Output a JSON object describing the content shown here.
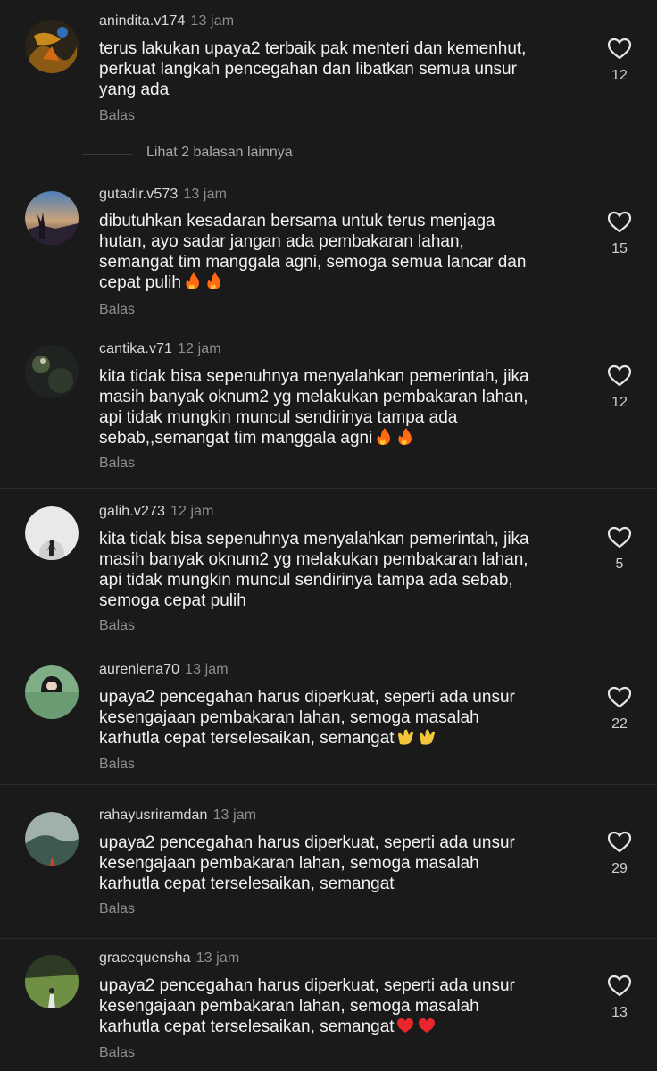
{
  "comments": [
    {
      "username": "anindita.v174",
      "time": "13 jam",
      "text": "terus lakukan upaya2 terbaik pak menteri dan kemenhut,\nperkuat langkah pencegahan dan libatkan semua unsur\nyang ada",
      "reply": "Balas",
      "likes": "12"
    },
    {
      "username": "gutadir.v573",
      "time": "13 jam",
      "text": "dibutuhkan kesadaran bersama untuk terus menjaga\nhutan, ayo sadar jangan ada pembakaran lahan,\nsemangat tim manggala agni, semoga semua lancar dan\ncepat pulih",
      "emoji": "fire-fire",
      "reply": "Balas",
      "likes": "15"
    },
    {
      "username": "cantika.v71",
      "time": "12 jam",
      "text": "kita tidak bisa sepenuhnya menyalahkan pemerintah, jika\nmasih banyak oknum2 yg melakukan pembakaran lahan,\napi tidak mungkin muncul sendirinya tampa ada\nsebab,,semangat tim manggala agni",
      "emoji": "fire-fire",
      "reply": "Balas",
      "likes": "12"
    },
    {
      "username": "galih.v273",
      "time": "12 jam",
      "text": "kita tidak bisa sepenuhnya menyalahkan pemerintah, jika\nmasih banyak oknum2 yg melakukan pembakaran lahan,\napi tidak mungkin muncul sendirinya tampa ada sebab,\nsemoga cepat pulih",
      "reply": "Balas",
      "likes": "5"
    },
    {
      "username": "aurenlena70",
      "time": "13 jam",
      "text": "upaya2 pencegahan harus diperkuat, seperti ada unsur\nkesengajaan pembakaran lahan, semoga masalah\nkarhutla cepat terselesaikan, semangat",
      "emoji": "clap-clap",
      "reply": "Balas",
      "likes": "22"
    },
    {
      "username": "rahayusriramdan",
      "time": "13 jam",
      "text": "upaya2 pencegahan harus diperkuat, seperti ada unsur\nkesengajaan pembakaran lahan, semoga masalah\nkarhutla cepat terselesaikan, semangat",
      "reply": "Balas",
      "likes": "29"
    },
    {
      "username": "gracequensha",
      "time": "13 jam",
      "text": "upaya2 pencegahan harus diperkuat, seperti ada unsur\nkesengajaan pembakaran lahan, semoga masalah\nkarhutla cepat terselesaikan, semangat",
      "emoji": "heart-heart",
      "reply": "Balas",
      "likes": "13"
    }
  ],
  "more_replies": "Lihat 2 balasan lainnya",
  "icons": {
    "like": "heart-outline-icon",
    "fire": "fire-emoji-icon",
    "clap": "clap-emoji-icon",
    "heart": "red-heart-emoji-icon"
  }
}
